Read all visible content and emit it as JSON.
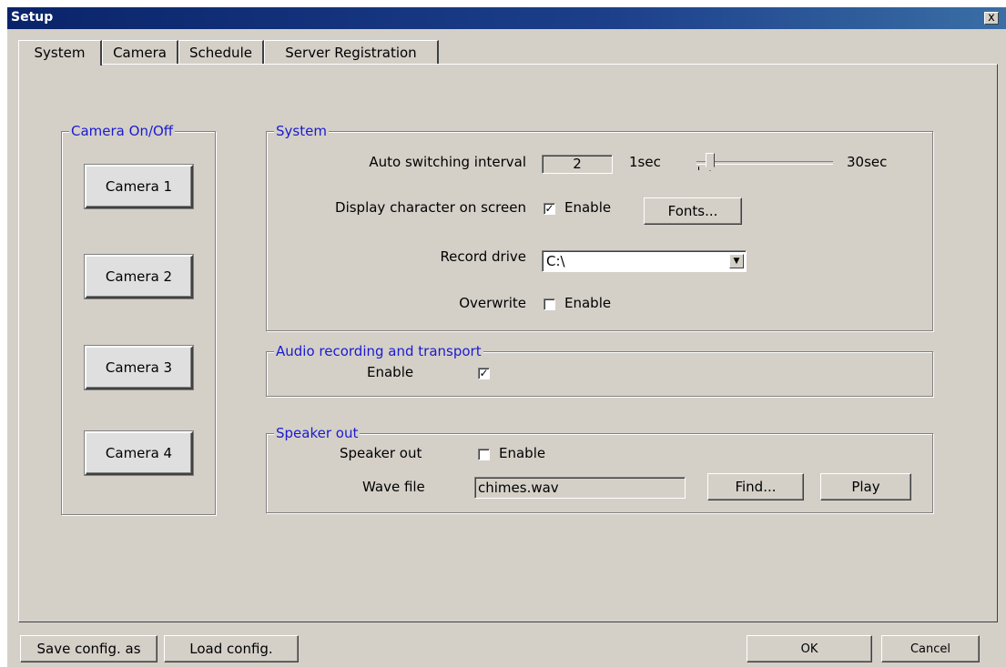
{
  "window": {
    "title": "Setup",
    "close_glyph": "x"
  },
  "tabs": [
    {
      "label": "System",
      "active": true
    },
    {
      "label": "Camera"
    },
    {
      "label": "Schedule"
    },
    {
      "label": "Server Registration"
    }
  ],
  "camera_group": {
    "title": "Camera On/Off",
    "buttons": [
      "Camera 1",
      "Camera 2",
      "Camera 3",
      "Camera 4"
    ]
  },
  "system_group": {
    "title": "System",
    "auto_switch_label": "Auto switching interval",
    "auto_switch_value": "2",
    "slider_min_label": "1sec",
    "slider_max_label": "30sec",
    "slider_value": 2,
    "display_char_label": "Display character on screen",
    "display_char_checkbox_label": "Enable",
    "display_char_checked": true,
    "fonts_button": "Fonts...",
    "record_drive_label": "Record drive",
    "record_drive_value": "C:\\",
    "overwrite_label": "Overwrite",
    "overwrite_checkbox_label": "Enable",
    "overwrite_checked": false
  },
  "audio_group": {
    "title": "Audio recording and transport",
    "enable_label": "Enable",
    "enable_checked": true
  },
  "speaker_group": {
    "title": "Speaker out",
    "speaker_label": "Speaker out",
    "speaker_checkbox_label": "Enable",
    "speaker_checked": false,
    "wave_label": "Wave file",
    "wave_value": "chimes.wav",
    "find_button": "Find...",
    "play_button": "Play"
  },
  "footer": {
    "save_button": "Save config. as",
    "load_button": "Load config.",
    "ok_button": "OK",
    "cancel_button": "Cancel"
  },
  "check_glyph": "✓"
}
